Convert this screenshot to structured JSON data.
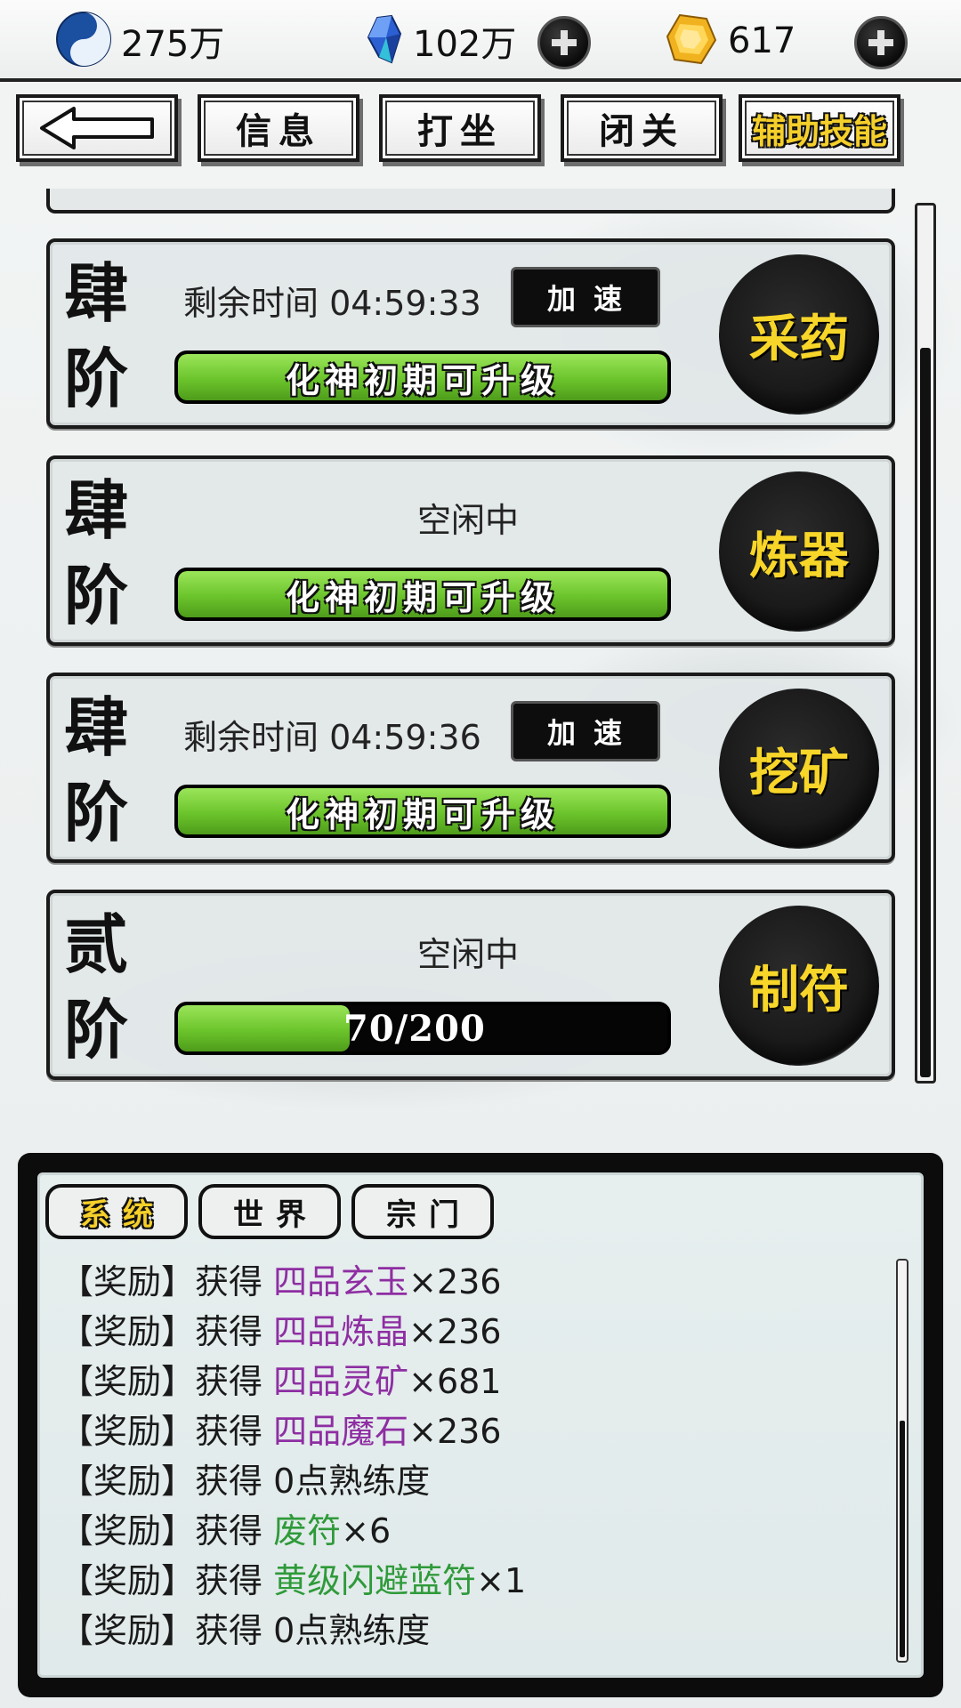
{
  "resources": {
    "cultivation": {
      "icon": "yin-yang-icon",
      "value": "275万"
    },
    "spirit_stone": {
      "icon": "blue-crystal-icon",
      "value": "102万"
    },
    "gold_gem": {
      "icon": "gold-gem-icon",
      "value": "617"
    }
  },
  "tabs": {
    "back_icon": "back-arrow-icon",
    "items": [
      "信息",
      "打坐",
      "闭关",
      "辅助技能"
    ],
    "active": "辅助技能"
  },
  "skills": [
    {
      "tier": "肆阶",
      "status": "剩余时间 04:59:33",
      "speed_label": "加速",
      "bar_text": "化神初期可升级",
      "progress": 1.0,
      "skill": "采药"
    },
    {
      "tier": "肆阶",
      "status": "空闲中",
      "bar_text": "化神初期可升级",
      "progress": 1.0,
      "skill": "炼器"
    },
    {
      "tier": "肆阶",
      "status": "剩余时间 04:59:36",
      "speed_label": "加速",
      "bar_text": "化神初期可升级",
      "progress": 1.0,
      "skill": "挖矿"
    },
    {
      "tier": "贰阶",
      "status": "空闲中",
      "bar_text": "70/200",
      "progress": 0.35,
      "skill": "制符"
    }
  ],
  "chat": {
    "tabs": [
      "系统",
      "世界",
      "宗门"
    ],
    "active_tab": "系统",
    "log": [
      {
        "prefix": "【奖励】获得 ",
        "item": "四品玄玉",
        "item_color": "purple",
        "suffix": "×236"
      },
      {
        "prefix": "【奖励】获得 ",
        "item": "四品炼晶",
        "item_color": "purple",
        "suffix": "×236"
      },
      {
        "prefix": "【奖励】获得 ",
        "item": "四品灵矿",
        "item_color": "purple",
        "suffix": "×681"
      },
      {
        "prefix": "【奖励】获得 ",
        "item": "四品魔石",
        "item_color": "purple",
        "suffix": "×236"
      },
      {
        "prefix": "【奖励】获得 0点熟练度",
        "item": "",
        "item_color": "",
        "suffix": ""
      },
      {
        "prefix": "【奖励】获得 ",
        "item": "废符",
        "item_color": "green",
        "suffix": "×6"
      },
      {
        "prefix": "【奖励】获得 ",
        "item": "黄级闪避蓝符",
        "item_color": "green",
        "suffix": "×1"
      },
      {
        "prefix": "【奖励】获得 0点熟练度",
        "item": "",
        "item_color": "",
        "suffix": ""
      }
    ]
  },
  "colors": {
    "accent_gold": "#f5cf2a",
    "bar_green": "#6bc42b",
    "item_purple": "#8e2ea2",
    "item_green": "#2f9a3a"
  }
}
